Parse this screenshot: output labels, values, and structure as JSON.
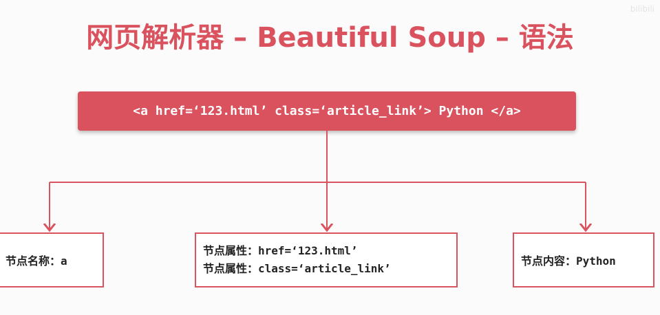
{
  "title": "网页解析器 – Beautiful Soup – 语法",
  "watermark": "bilibili",
  "code": "<a href=‘123.html’ class=‘article_link’> Python </a>",
  "nodes": {
    "name": {
      "label": "节点名称：",
      "value": "a"
    },
    "attr1": {
      "label": "节点属性：",
      "value": "href=‘123.html’"
    },
    "attr2": {
      "label": "节点属性：",
      "value": "class=‘article_link’"
    },
    "content": {
      "label": "节点内容：",
      "value": "Python"
    }
  },
  "colors": {
    "accent": "#d9525e",
    "text": "#222222",
    "background": "#fbfbfb"
  }
}
